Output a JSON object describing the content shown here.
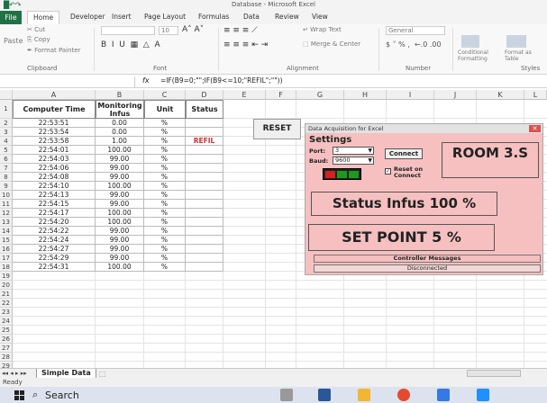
{
  "window": {
    "title": "Database - Microsoft Excel"
  },
  "ribbon": {
    "tabs": [
      "File",
      "Home",
      "Developer",
      "Insert",
      "Page Layout",
      "Formulas",
      "Data",
      "Review",
      "View"
    ],
    "clipboard": {
      "cut": "Cut",
      "copy": "Copy",
      "format_painter": "Format Painter",
      "paste": "Paste",
      "label": "Clipboard"
    },
    "font": {
      "label": "Font",
      "size": "10"
    },
    "alignment": {
      "wrap": "Wrap Text",
      "merge": "Merge & Center",
      "label": "Alignment"
    },
    "number": {
      "format": "General",
      "label": "Number"
    },
    "styles": {
      "conditional": "Conditional Formatting",
      "format_table": "Format as Table",
      "label": "Styles"
    }
  },
  "formula_bar": {
    "fx": "fx",
    "formula": "=IF(B9=0;\"\";IF(B9<=10;\"REFIL\";\"\"))"
  },
  "columns": [
    "A",
    "B",
    "C",
    "D",
    "E",
    "F",
    "G",
    "H",
    "I",
    "J",
    "K",
    "L"
  ],
  "table": {
    "headers": [
      "Computer Time",
      "Monitoring Infus",
      "Unit",
      "Status"
    ],
    "rows": [
      [
        "22:53:51",
        "0.00",
        "%",
        ""
      ],
      [
        "22:53:54",
        "0.00",
        "%",
        ""
      ],
      [
        "22:53:58",
        "1.00",
        "%",
        "REFIL"
      ],
      [
        "22:54:01",
        "100.00",
        "%",
        ""
      ],
      [
        "22:54:03",
        "99.00",
        "%",
        ""
      ],
      [
        "22:54:06",
        "99.00",
        "%",
        ""
      ],
      [
        "22:54:08",
        "99.00",
        "%",
        ""
      ],
      [
        "22:54:10",
        "100.00",
        "%",
        ""
      ],
      [
        "22:54:13",
        "99.00",
        "%",
        ""
      ],
      [
        "22:54:15",
        "99.00",
        "%",
        ""
      ],
      [
        "22:54:17",
        "100.00",
        "%",
        ""
      ],
      [
        "22:54:20",
        "100.00",
        "%",
        ""
      ],
      [
        "22:54:22",
        "99.00",
        "%",
        ""
      ],
      [
        "22:54:24",
        "99.00",
        "%",
        ""
      ],
      [
        "22:54:27",
        "99.00",
        "%",
        ""
      ],
      [
        "22:54:29",
        "99.00",
        "%",
        ""
      ],
      [
        "22:54:31",
        "100.00",
        "%",
        ""
      ]
    ]
  },
  "reset_button": "RESET",
  "form": {
    "title": "Data Acquisition for Excel",
    "settings": "Settings",
    "port_label": "Port:",
    "port_value": "3",
    "baud_label": "Baud:",
    "baud_value": "9600",
    "connect": "Connect",
    "reset_on_connect": "Reset on Connect",
    "room": "ROOM 3.S",
    "status_infus": "Status Infus 100 %",
    "set_point": "SET POINT 5 %",
    "controller_messages": "Controller Messages",
    "connection_status": "Disconnected",
    "led_colors": [
      "#d62020",
      "#1c9a1c",
      "#1c9a1c"
    ]
  },
  "sheet_tab": "Simple Data",
  "status_bar": "Ready",
  "taskbar": {
    "search": "Search"
  },
  "colors": {
    "excel_green": "#1f7244",
    "form_bg": "#f6c0c0",
    "refil_red": "#d23030"
  }
}
